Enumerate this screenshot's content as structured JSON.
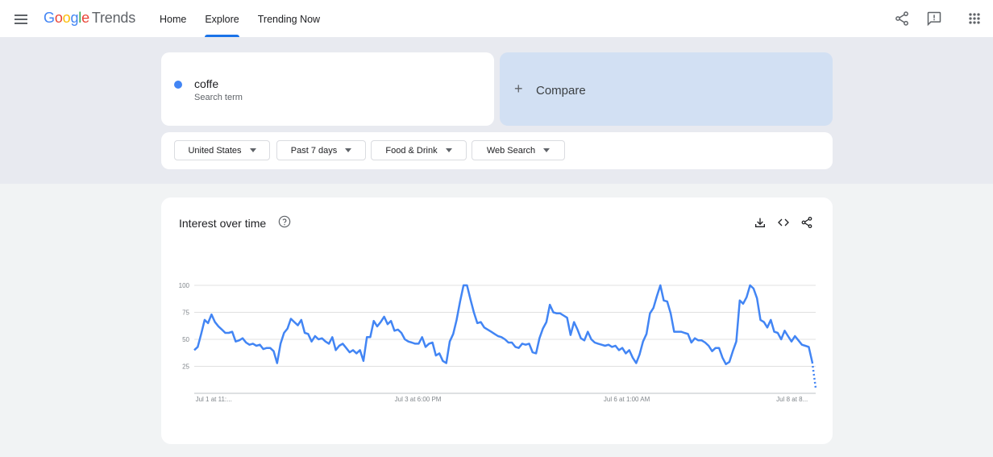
{
  "header": {
    "logo_google": "Google",
    "logo_trends": "Trends",
    "nav": [
      {
        "label": "Home",
        "active": false
      },
      {
        "label": "Explore",
        "active": true
      },
      {
        "label": "Trending Now",
        "active": false
      }
    ],
    "icons": [
      "menu-icon",
      "share-icon",
      "feedback-icon",
      "apps-icon"
    ]
  },
  "search": {
    "term": "coffe",
    "term_sub": "Search term",
    "term_color": "#4285f4",
    "compare_label": "Compare"
  },
  "filters": [
    {
      "label": "United States"
    },
    {
      "label": "Past 7 days"
    },
    {
      "label": "Food & Drink"
    },
    {
      "label": "Web Search"
    }
  ],
  "chart_card": {
    "title": "Interest over time",
    "icons": [
      "help-icon",
      "download-icon",
      "embed-icon",
      "share-icon"
    ]
  },
  "chart_data": {
    "type": "line",
    "ylim": [
      0,
      100
    ],
    "yticks": [
      25,
      50,
      75,
      100
    ],
    "xtick_labels": [
      "Jul 1 at 11:...",
      "Jul 3 at 6:00 PM",
      "Jul 6 at 1:00 AM",
      "Jul 8 at 8..."
    ],
    "grid": true,
    "series_color": "#4285f4",
    "series": [
      {
        "name": "coffe",
        "values": [
          40,
          43,
          55,
          68,
          65,
          73,
          66,
          62,
          59,
          56,
          56,
          57,
          48,
          49,
          51,
          47,
          45,
          46,
          44,
          45,
          41,
          42,
          42,
          39,
          28,
          46,
          56,
          60,
          69,
          66,
          63,
          68,
          56,
          55,
          48,
          53,
          50,
          51,
          48,
          46,
          52,
          40,
          44,
          46,
          42,
          38,
          40,
          37,
          40,
          30,
          52,
          52,
          67,
          62,
          66,
          71,
          64,
          67,
          58,
          59,
          56,
          50,
          48,
          47,
          46,
          46,
          52,
          43,
          46,
          47,
          35,
          37,
          30,
          28,
          48,
          55,
          68,
          85,
          100,
          100,
          87,
          75,
          65,
          66,
          61,
          59,
          57,
          55,
          53,
          52,
          50,
          47,
          47,
          43,
          42,
          46,
          45,
          46,
          38,
          37,
          51,
          60,
          66,
          82,
          75,
          74,
          74,
          72,
          70,
          54,
          66,
          59,
          51,
          49,
          57,
          50,
          47,
          46,
          45,
          44,
          45,
          43,
          44,
          40,
          42,
          37,
          40,
          33,
          28,
          36,
          48,
          55,
          74,
          79,
          90,
          100,
          86,
          85,
          74,
          57,
          57,
          57,
          56,
          55,
          47,
          51,
          49,
          49,
          47,
          44,
          39,
          42,
          42,
          33,
          27,
          29,
          39,
          48,
          86,
          83,
          89,
          100,
          97,
          88,
          68,
          66,
          61,
          68,
          57,
          56,
          50,
          58,
          53,
          48,
          53,
          49,
          45,
          44,
          43,
          29,
          5
        ]
      }
    ],
    "dashed_last_segment": true
  }
}
